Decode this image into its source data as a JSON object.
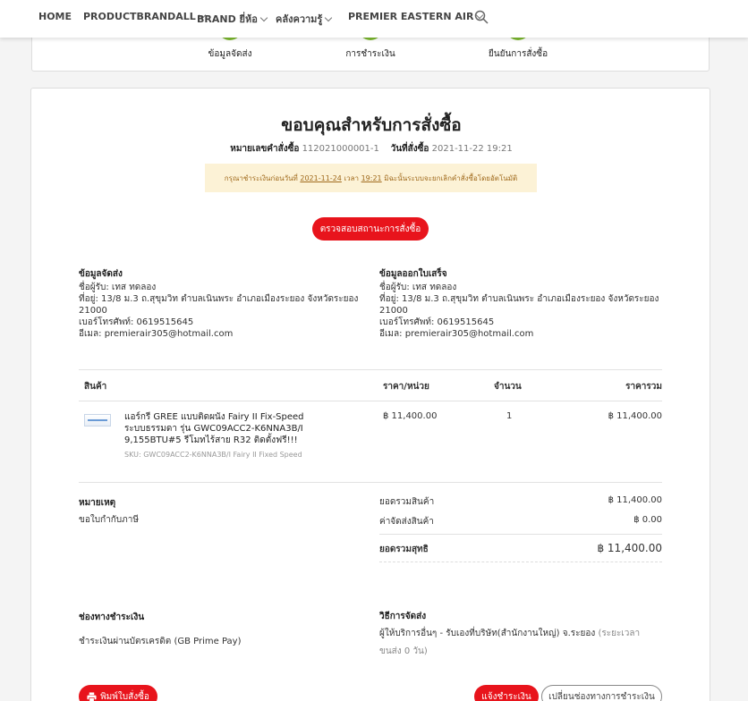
{
  "nav": {
    "home": "HOME",
    "productbrandall": "PRODUCTBRANDALL",
    "brand": "BRAND ยี่ห้อ",
    "knowledge": "คลังความรู้",
    "premier": "PREMIER EASTERN AIR"
  },
  "steps": [
    "ข้อมูลจัดส่ง",
    "การชำระเงิน",
    "ยืนยันการสั่งซื้อ"
  ],
  "page": {
    "title": "ขอบคุณสำหรับการสั่งซื้อ",
    "order_no_label": "หมายเลขคำสั่งซื้อ",
    "order_no": "112021000001-1",
    "order_date_label": "วันที่สั่งซื้อ",
    "order_date": "2021-11-22 19:21",
    "warning": {
      "prefix": "กรุณาชำระเงินก่อนวันที่",
      "date": "2021-11-24",
      "time_word": "เวลา",
      "time": "19:21",
      "suffix": "มิฉะนั้นระบบจะยกเลิกคำสั่งซื้อโดยอัตโนมัติ"
    },
    "check_status_button": "ตรวจสอบสถานะการสั่งซื้อ"
  },
  "shipping": {
    "heading": "ข้อมูลจัดส่ง",
    "name": "ชื่อผู้รับ: เทส ทดลอง",
    "address": "ที่อยู่: 13/8 ม.3 ถ.สุขุมวิท ตำบลเนินพระ อำเภอเมืองระยอง จังหวัดระยอง 21000",
    "phone": "เบอร์โทรศัพท์: 0619515645",
    "email": "อีเมล: premierair305@hotmail.com"
  },
  "billing": {
    "heading": "ข้อมูลออกใบเสร็จ",
    "name": "ชื่อผู้รับ: เทส ทดลอง",
    "address": "ที่อยู่: 13/8 ม.3 ถ.สุขุมวิท ตำบลเนินพระ อำเภอเมืองระยอง จังหวัดระยอง 21000",
    "phone": "เบอร์โทรศัพท์: 0619515645",
    "email": "อีเมล: premierair305@hotmail.com"
  },
  "table": {
    "headers": {
      "product": "สินค้า",
      "price": "ราคา/หน่วย",
      "qty": "จำนวน",
      "total": "ราคารวม"
    },
    "rows": [
      {
        "name": "แอร์กรี GREE แบบติดผนัง Fairy II Fix-Speed ระบบธรรมดา รุ่น GWC09ACC2-K6NNA3B/I 9,155BTU#5 รีโมทไร้สาย R32 ติดตั้งฟรี!!!",
        "sku": "SKU: GWC09ACC2-K6NNA3B/I Fairy II Fixed Speed",
        "price": "฿ 11,400.00",
        "qty": "1",
        "total": "฿ 11,400.00"
      }
    ]
  },
  "remark": {
    "heading": "หมายเหตุ",
    "text": "ขอใบกำกับภาษี"
  },
  "summary": {
    "subtotal_label": "ยอดรวมสินค้า",
    "subtotal": "฿ 11,400.00",
    "shipping_label": "ค่าจัดส่งสินค้า",
    "shipping": "฿ 0.00",
    "net_label": "ยอดรวมสุทธิ",
    "net": "฿ 11,400.00"
  },
  "payment": {
    "heading": "ช่องทางชำระเงิน",
    "text": "ชำระเงินผ่านบัตรเครดิต (GB Prime Pay)"
  },
  "delivery": {
    "heading": "วิธีการจัดส่ง",
    "text": "ผู้ให้บริการอื่นๆ - รับเองที่บริษัท(สำนักงานใหญ่) จ.ระยอง",
    "time": "(ระยะเวลาขนส่ง 0 วัน)"
  },
  "actions": {
    "print": "พิมพ์ใบสั่งซื้อ",
    "notify_payment": "แจ้งชำระเงิน",
    "change_payment": "เปลี่ยนช่องทางการชำระเงิน"
  }
}
